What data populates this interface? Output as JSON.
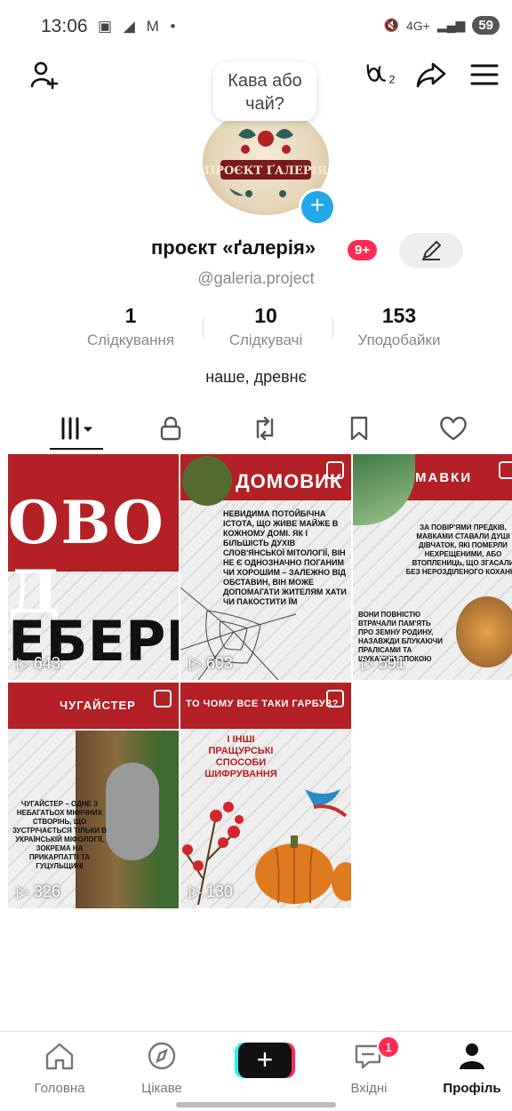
{
  "status": {
    "time": "13:06",
    "icons": "▣ ◢ M •",
    "signal": "4G+",
    "battery": "59"
  },
  "header": {
    "bubble_text": "Кава або чай?"
  },
  "profile": {
    "name": "проєкт «ґалерія»",
    "badge": "9+",
    "handle": "@galeria.project",
    "bio": "наше, древнє",
    "logo_text": "ПРОЄКТ ҐАЛЕРІЯ"
  },
  "stats": [
    {
      "value": "1",
      "label": "Слідкування"
    },
    {
      "value": "10",
      "label": "Слідкувачі"
    },
    {
      "value": "153",
      "label": "Уподобайки"
    }
  ],
  "videos": [
    {
      "views": "643",
      "title": "ОВО Д",
      "subtitle": "ЕБЕРІ"
    },
    {
      "views": "603",
      "title": "ДОМОВИК",
      "caption": "НЕВИДИМА ПОТОЙБІЧНА ІСТОТА, ЩО ЖИВЕ МАЙЖЕ В КОЖНОМУ ДОМІ. ЯК І БІЛЬШІСТЬ ДУХІВ СЛОВ'ЯНСЬКОЇ МІТОЛОГІЇ, ВІН НЕ Є ОДНОЗНАЧНО ПОГАНИМ ЧИ ХОРОШИМ – ЗАЛЕЖНО ВІД ОБСТАВИН, ВІН МОЖЕ ДОПОМАГАТИ ЖИТЕЛЯМ ХАТИ ЧИ ПАКОСТИТИ ЇМ"
    },
    {
      "views": "591",
      "title": "МАВКИ",
      "caption": "ЗА ПОВІР'ЯМИ ПРЕДКІВ, МАВКАМИ СТАВАЛИ ДУШІ ДІВЧАТОК, ЯКІ ПОМЕРЛИ НЕХРЕЩЕНИМИ, АБО ВТОПЛЕНИЦЬ, ЩО ЗГАСАЛИ БЕЗ НЕРОЗДІЛЕНОГО КОХАННЯ",
      "caption2": "ВОНИ ПОВНІСТЮ ВТРАЧАЛИ ПАМ'ЯТЬ ПРО ЗЕМНУ РОДИНУ, НАЗАВЖДИ БЛУКАЮЧИ ПРАЛІСАМИ ТА ШУКАЮЧИ СПОКОЮ"
    },
    {
      "views": "326",
      "title": "ЧУГАЙСТЕР",
      "caption": "ЧУГАЙСТЕР – ОДНЕ З НЕБАГАТЬОХ МІФІЧНИХ СТВОРІНЬ, ЩО ЗУСТРІЧАЄТЬСЯ ТІЛЬКИ В УКРАЇНСЬКІЙ МІФОЛОГІЇ, ЗОКРЕМА НА ПРИКАРПАТТІ ТА ГУЦУЛЬЩИНІ"
    },
    {
      "views": "130",
      "title": "ТО ЧОМУ ВСЕ ТАКИ ГАРБУЗ?",
      "caption": "І ІНШІ ПРАЩУРСЬКІ СПОСОБИ ШИФРУВАННЯ"
    }
  ],
  "nav": [
    {
      "label": "Головна"
    },
    {
      "label": "Цікаве"
    },
    {
      "label": "Вхідні",
      "badge": "1"
    },
    {
      "label": "Профіль"
    }
  ]
}
